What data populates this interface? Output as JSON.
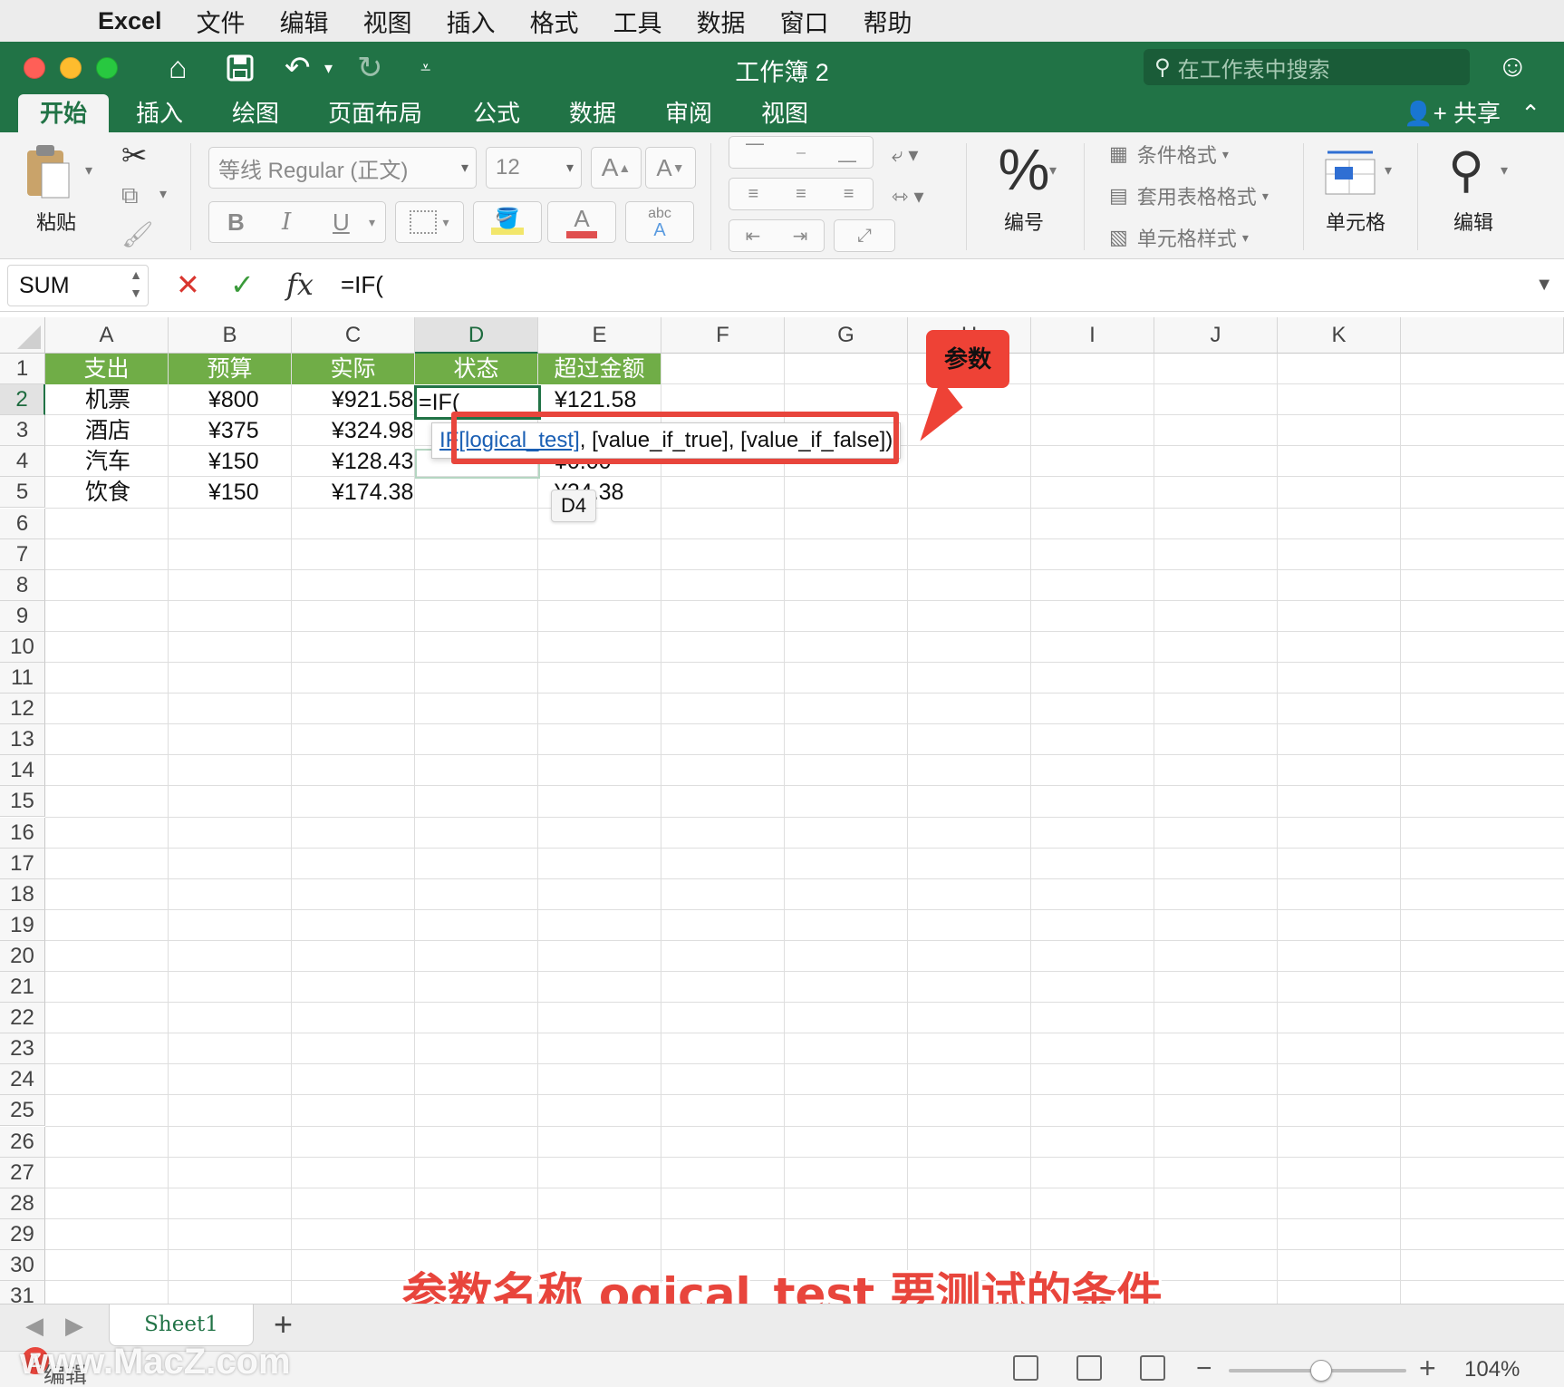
{
  "menubar": {
    "app_name": "Excel",
    "items": [
      "文件",
      "编辑",
      "视图",
      "插入",
      "格式",
      "工具",
      "数据",
      "窗口",
      "帮助"
    ]
  },
  "titlebar": {
    "doc_title": "工作簿 2",
    "search_placeholder": "在工作表中搜索"
  },
  "ribbon_tabs": {
    "tabs": [
      "开始",
      "插入",
      "绘图",
      "页面布局",
      "公式",
      "数据",
      "审阅",
      "视图"
    ],
    "active": "开始",
    "share_label": "共享"
  },
  "ribbon": {
    "paste_label": "粘贴",
    "font_name": "等线 Regular (正文)",
    "font_size": "12",
    "grow_font": "A",
    "shrink_font": "A",
    "bold": "B",
    "italic": "I",
    "underline": "U",
    "font_color_glyph": "A",
    "phonetic_glyph": "abc",
    "number_label": "编号",
    "conditional_format": "条件格式",
    "table_format": "套用表格格式",
    "cell_styles": "单元格样式",
    "cells_label": "单元格",
    "editing_label": "编辑"
  },
  "formula_bar": {
    "name_box": "SUM",
    "cancel_glyph": "✕",
    "enter_glyph": "✓",
    "fx_glyph": "fx",
    "formula": "=IF("
  },
  "grid": {
    "columns": [
      "A",
      "B",
      "C",
      "D",
      "E",
      "F",
      "G",
      "H",
      "I",
      "J",
      "K"
    ],
    "selected_column": "D",
    "rows": [
      "1",
      "2",
      "3",
      "4",
      "5",
      "6",
      "7",
      "8",
      "9",
      "10",
      "11",
      "12",
      "13",
      "14",
      "15",
      "16",
      "17",
      "18",
      "19",
      "20",
      "21",
      "22",
      "23",
      "24",
      "25",
      "26",
      "27",
      "28",
      "29",
      "30",
      "31"
    ],
    "selected_row": "2",
    "header_row": [
      "支出",
      "预算",
      "实际",
      "状态",
      "超过金额"
    ],
    "data": [
      [
        "机票",
        "¥800",
        "¥921.58",
        "=IF(",
        "¥121.58"
      ],
      [
        "酒店",
        "¥375",
        "¥324.98",
        "",
        ""
      ],
      [
        "汽车",
        "¥150",
        "¥128.43",
        "",
        "¥0.00"
      ],
      [
        "饮食",
        "¥150",
        "¥174.38",
        "",
        "¥24.38"
      ]
    ],
    "header_fill": "#70ad47"
  },
  "tooltip": {
    "function_name": "IF",
    "arg1": "[logical_test]",
    "rest": ", [value_if_true], [value_if_false])"
  },
  "annotation": {
    "callout": "参数",
    "cell_ref_tip": "D4",
    "subtitle": "参数名称 ogical_test 要测试的条件"
  },
  "sheets": {
    "tab": "Sheet1",
    "add": "+"
  },
  "statusbar": {
    "mode": "编辑",
    "zoom": "104%",
    "zoom_fraction": 0.52,
    "watermark": "www.MacZ.com",
    "watermark_logo": "Z"
  },
  "colors": {
    "excel_green": "#217346",
    "header_green": "#70ad47",
    "annotation_red": "#e8453c"
  }
}
